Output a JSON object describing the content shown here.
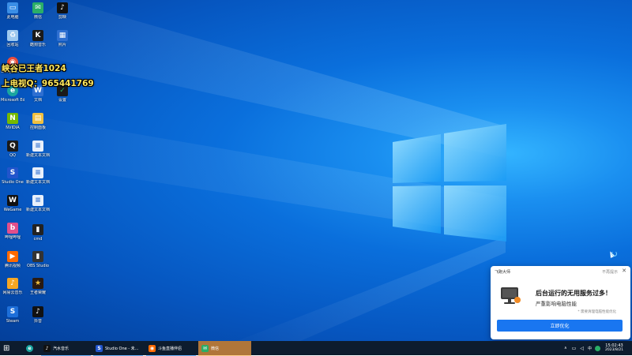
{
  "desktop": {
    "icons": [
      {
        "label": "此电脑",
        "color": "#3a8ee6",
        "glyph": "▭"
      },
      {
        "label": "回收站",
        "color": "#9ec9ef",
        "glyph": "♻"
      },
      {
        "label": "Google Chrome",
        "color": "#e84c3d",
        "glyph": "◉"
      },
      {
        "label": "Microsoft Edge",
        "color": "#1aa6a0",
        "glyph": "e"
      },
      {
        "label": "NVIDIA",
        "color": "#76b900",
        "glyph": "N"
      },
      {
        "label": "QQ",
        "color": "#1a1a1a",
        "glyph": "Q"
      },
      {
        "label": "Studio One",
        "color": "#2255cc",
        "glyph": "S"
      },
      {
        "label": "WeGame",
        "color": "#111111",
        "glyph": "W"
      },
      {
        "label": "哔哩哔哩",
        "color": "#e24f8b",
        "glyph": "b"
      },
      {
        "label": "腾讯视频",
        "color": "#ff6a00",
        "glyph": "▶"
      },
      {
        "label": "网易云音乐",
        "color": "#f5a623",
        "glyph": "♪"
      },
      {
        "label": "Steam",
        "color": "#1e6fd9",
        "glyph": "S"
      },
      {
        "label": "微信",
        "color": "#2aae67",
        "glyph": "✉"
      },
      {
        "label": "酷狗音乐",
        "color": "#1a1a1a",
        "glyph": "K"
      },
      {
        "label": "文档",
        "color": "#2e6fd1",
        "glyph": "W"
      },
      {
        "label": "控制面板",
        "color": "#1a1a1a",
        "glyph": "S"
      },
      {
        "label": "表格",
        "color": "#f0c040",
        "glyph": "▤"
      },
      {
        "label": "新建文本文档",
        "color": "#e8f0fb",
        "glyph": "≡"
      },
      {
        "label": "新建文本文档 (2)",
        "color": "#e8f0fb",
        "glyph": "≡"
      },
      {
        "label": "新建文本文档 (3)",
        "color": "#e8f0fb",
        "glyph": "≡"
      },
      {
        "label": "cmd",
        "color": "#222222",
        "glyph": "▮"
      },
      {
        "label": "OBS Studio",
        "color": "#333333",
        "glyph": "▮"
      },
      {
        "label": "王者荣耀",
        "color": "#2a1a10",
        "glyph": "★"
      },
      {
        "label": "剪映",
        "color": "#111111",
        "glyph": "♪"
      },
      {
        "label": "抖音",
        "color": "#111111",
        "glyph": "♪"
      },
      {
        "label": "照片",
        "color": "#2e6fd1",
        "glyph": "▦"
      },
      {
        "label": "设置",
        "color": "#1a1a1a",
        "glyph": "✓"
      }
    ]
  },
  "overlay": {
    "line1": "峡谷已王者1024",
    "line2": "上电视Q：965441769"
  },
  "popup": {
    "app_name": "飞跑大师",
    "dismiss_label": "不再提示",
    "close_glyph": "✕",
    "title": "后台运行的无用服务过多！",
    "subtitle": "严重影响电脑性能",
    "note": "* 需要清理电脑性能优化",
    "button": "立即优化"
  },
  "taskbar": {
    "start_glyph": "⊞",
    "apps": [
      {
        "label": "",
        "color": "#1aa6a0",
        "glyph": "e"
      },
      {
        "label": "汽水音乐",
        "color": "#111111",
        "glyph": "♪"
      },
      {
        "label": "Studio One - 未...",
        "color": "#2255cc",
        "glyph": "S"
      },
      {
        "label": "斗鱼直播伴侣",
        "color": "#ff6a00",
        "glyph": "◉"
      },
      {
        "label": "微信",
        "color": "#2aae67",
        "glyph": "✉"
      }
    ],
    "tray": {
      "chevron": "∧",
      "language": "中",
      "time": "15:02:43",
      "date": "2023/8/21"
    }
  },
  "colors": {
    "accent": "#1976f0",
    "overlay_text": "#ffe65c",
    "taskbar": "#0d1c2e"
  }
}
